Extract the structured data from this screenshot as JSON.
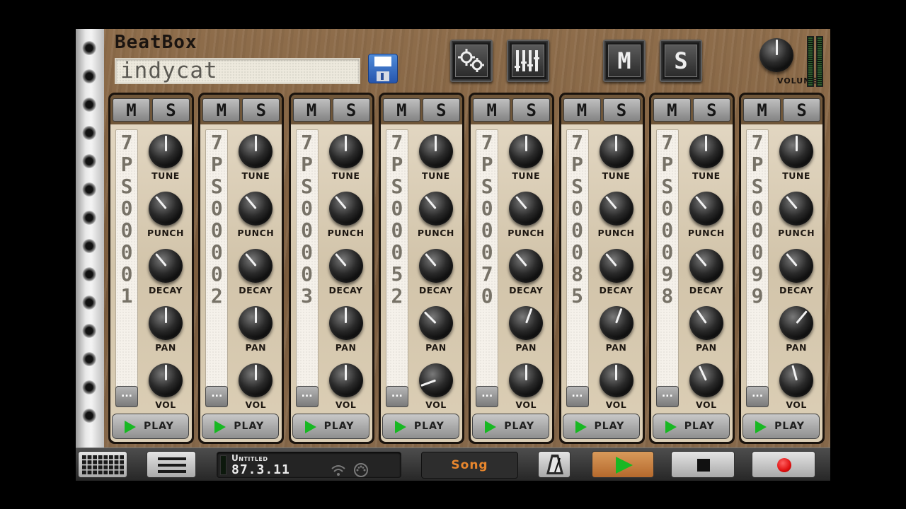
{
  "app": {
    "logo": "BeatBox",
    "pattern_name": "indycat",
    "volume_label": "VOLUME",
    "mute_label": "M",
    "solo_label": "S"
  },
  "icons": {
    "save": "floppy-disk-icon",
    "settings": "gears-icon",
    "mixer": "mixer-bars-icon",
    "pads": "pad-grid-icon",
    "menu": "hamburger-menu-icon",
    "metronome": "metronome-icon",
    "play": "play-icon",
    "stop": "stop-icon",
    "record": "record-icon"
  },
  "knob_labels": [
    "TUNE",
    "PUNCH",
    "DECAY",
    "PAN",
    "VOL"
  ],
  "channels": [
    {
      "m": "M",
      "s": "S",
      "sample": "7PS00001",
      "more": "...",
      "play": "PLAY"
    },
    {
      "m": "M",
      "s": "S",
      "sample": "7PS00002",
      "more": "...",
      "play": "PLAY"
    },
    {
      "m": "M",
      "s": "S",
      "sample": "7PS00003",
      "more": "...",
      "play": "PLAY"
    },
    {
      "m": "M",
      "s": "S",
      "sample": "7PS00052",
      "more": "...",
      "play": "PLAY"
    },
    {
      "m": "M",
      "s": "S",
      "sample": "7PS00070",
      "more": "...",
      "play": "PLAY"
    },
    {
      "m": "M",
      "s": "S",
      "sample": "7PS00085",
      "more": "...",
      "play": "PLAY"
    },
    {
      "m": "M",
      "s": "S",
      "sample": "7PS00098",
      "more": "...",
      "play": "PLAY"
    },
    {
      "m": "M",
      "s": "S",
      "sample": "7PS00099",
      "more": "...",
      "play": "PLAY"
    }
  ],
  "knob_angles": [
    [
      0,
      -40,
      -40,
      0,
      0
    ],
    [
      0,
      -40,
      -40,
      0,
      0
    ],
    [
      0,
      -40,
      -40,
      0,
      0
    ],
    [
      0,
      -40,
      -40,
      -45,
      -110
    ],
    [
      0,
      -40,
      -40,
      20,
      0
    ],
    [
      0,
      -40,
      -40,
      20,
      0
    ],
    [
      0,
      -40,
      -40,
      -35,
      -25
    ],
    [
      0,
      -40,
      -40,
      40,
      -15
    ]
  ],
  "master_volume_angle": 0,
  "transport": {
    "status_title": "Untitled",
    "status_time": "87.3.11",
    "song_label": "Song"
  },
  "colors": {
    "wood": "#8e6d4b",
    "play_green": "#18b823",
    "song_orange": "#e8862d",
    "record_red": "#e01010"
  }
}
